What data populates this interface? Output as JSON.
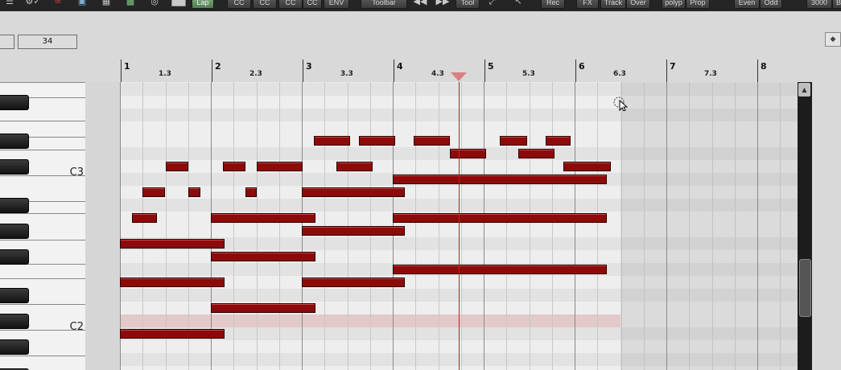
{
  "toolbar": {
    "buttons": [
      {
        "label": "Lap",
        "style": "green"
      },
      {
        "label": "CC"
      },
      {
        "label": "CC"
      },
      {
        "label": "CC"
      },
      {
        "label": "CC"
      },
      {
        "label": "ENV"
      },
      {
        "label": "Toolbar"
      },
      {
        "label": "Tool"
      },
      {
        "label": "Rec"
      },
      {
        "label": "FX"
      },
      {
        "label": "Track"
      },
      {
        "label": "Over"
      },
      {
        "label": "polyp"
      },
      {
        "label": "Prop"
      },
      {
        "label": "Even"
      },
      {
        "label": "Odd"
      },
      {
        "label": "3000"
      },
      {
        "label": "Bi"
      }
    ]
  },
  "grid_field": {
    "value": "34"
  },
  "ruler": {
    "bars": [
      "1",
      "2",
      "3",
      "4",
      "5",
      "6",
      "7",
      "8"
    ],
    "beats": [
      "1.3",
      "2.3",
      "3.3",
      "4.3",
      "5.3",
      "6.3",
      "7.3"
    ]
  },
  "keyboard": {
    "labels": [
      {
        "text": "C3",
        "row": 7
      },
      {
        "text": "C2",
        "row": 19
      }
    ]
  },
  "piano_roll": {
    "note_color": "#8d0a0a",
    "playhead_beat": 3.73,
    "notes": [
      {
        "start": 2.13,
        "end": 2.53,
        "row": 4
      },
      {
        "start": 2.63,
        "end": 3.03,
        "row": 4
      },
      {
        "start": 3.23,
        "end": 3.63,
        "row": 4
      },
      {
        "start": 4.18,
        "end": 4.48,
        "row": 4
      },
      {
        "start": 4.68,
        "end": 4.95,
        "row": 4
      },
      {
        "start": 3.63,
        "end": 4.03,
        "row": 5
      },
      {
        "start": 4.38,
        "end": 4.78,
        "row": 5
      },
      {
        "start": 0.5,
        "end": 0.75,
        "row": 6
      },
      {
        "start": 1.13,
        "end": 1.38,
        "row": 6
      },
      {
        "start": 1.5,
        "end": 2.0,
        "row": 6
      },
      {
        "start": 2.38,
        "end": 2.78,
        "row": 6
      },
      {
        "start": 4.88,
        "end": 5.4,
        "row": 6
      },
      {
        "start": 3.0,
        "end": 5.35,
        "row": 7
      },
      {
        "start": 0.25,
        "end": 0.5,
        "row": 8
      },
      {
        "start": 0.75,
        "end": 0.88,
        "row": 8
      },
      {
        "start": 1.38,
        "end": 1.5,
        "row": 8
      },
      {
        "start": 2.0,
        "end": 3.13,
        "row": 8
      },
      {
        "start": 0.13,
        "end": 0.4,
        "row": 10
      },
      {
        "start": 1.0,
        "end": 2.15,
        "row": 10
      },
      {
        "start": 3.0,
        "end": 5.35,
        "row": 10
      },
      {
        "start": 2.0,
        "end": 3.13,
        "row": 11
      },
      {
        "start": 0.0,
        "end": 1.15,
        "row": 12
      },
      {
        "start": 1.0,
        "end": 2.15,
        "row": 13
      },
      {
        "start": 3.0,
        "end": 5.35,
        "row": 14
      },
      {
        "start": 0.0,
        "end": 1.15,
        "row": 15
      },
      {
        "start": 2.0,
        "end": 3.13,
        "row": 15
      },
      {
        "start": 1.0,
        "end": 2.15,
        "row": 17
      },
      {
        "start": 0.0,
        "end": 1.15,
        "row": 19
      }
    ]
  }
}
